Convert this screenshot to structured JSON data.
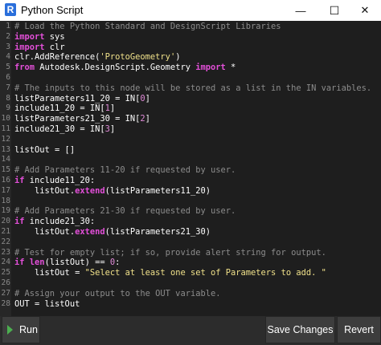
{
  "window": {
    "title": "Python Script",
    "app_icon_letter": "R",
    "minimize_glyph": "—",
    "maximize_glyph": "☐",
    "close_glyph": "✕",
    "icons": [
      "app-icon",
      "minimize-icon",
      "maximize-icon",
      "close-icon",
      "play-icon"
    ]
  },
  "colors": {
    "keyword": "#e34fd9",
    "comment": "#8c8c8c",
    "string": "#f0e18a",
    "number": "#e08ad8",
    "code_text": "#ffffff",
    "editor_bg": "#1e1e1e",
    "run_icon": "#4caf50"
  },
  "editor": {
    "lines": [
      {
        "n": "1",
        "tokens": [
          {
            "t": "# Load the Python Standard and DesignScript Libraries",
            "c": "cm"
          }
        ]
      },
      {
        "n": "2",
        "tokens": [
          {
            "t": "import",
            "c": "kw"
          },
          {
            "t": " sys",
            "c": ""
          }
        ]
      },
      {
        "n": "3",
        "tokens": [
          {
            "t": "import",
            "c": "kw"
          },
          {
            "t": " clr",
            "c": ""
          }
        ]
      },
      {
        "n": "4",
        "tokens": [
          {
            "t": "clr.AddReference(",
            "c": ""
          },
          {
            "t": "'ProtoGeometry'",
            "c": "st"
          },
          {
            "t": ")",
            "c": ""
          }
        ]
      },
      {
        "n": "5",
        "tokens": [
          {
            "t": "from",
            "c": "kw"
          },
          {
            "t": " Autodesk.DesignScript.Geometry ",
            "c": ""
          },
          {
            "t": "import",
            "c": "kw"
          },
          {
            "t": " *",
            "c": ""
          }
        ]
      },
      {
        "n": "6",
        "tokens": []
      },
      {
        "n": "7",
        "tokens": [
          {
            "t": "# The inputs to this node will be stored as a list in the IN variables.",
            "c": "cm"
          }
        ]
      },
      {
        "n": "8",
        "tokens": [
          {
            "t": "listParameters11_20 = IN[",
            "c": ""
          },
          {
            "t": "0",
            "c": "nm"
          },
          {
            "t": "]",
            "c": ""
          }
        ]
      },
      {
        "n": "9",
        "tokens": [
          {
            "t": "include11_20 = IN[",
            "c": ""
          },
          {
            "t": "1",
            "c": "nm"
          },
          {
            "t": "]",
            "c": ""
          }
        ]
      },
      {
        "n": "10",
        "tokens": [
          {
            "t": "listParameters21_30 = IN[",
            "c": ""
          },
          {
            "t": "2",
            "c": "nm"
          },
          {
            "t": "]",
            "c": ""
          }
        ]
      },
      {
        "n": "11",
        "tokens": [
          {
            "t": "include21_30 = IN[",
            "c": ""
          },
          {
            "t": "3",
            "c": "nm"
          },
          {
            "t": "]",
            "c": ""
          }
        ]
      },
      {
        "n": "12",
        "tokens": []
      },
      {
        "n": "13",
        "tokens": [
          {
            "t": "listOut = []",
            "c": ""
          }
        ]
      },
      {
        "n": "14",
        "tokens": []
      },
      {
        "n": "15",
        "tokens": [
          {
            "t": "# Add Parameters 11-20 if requested by user.",
            "c": "cm"
          }
        ]
      },
      {
        "n": "16",
        "tokens": [
          {
            "t": "if",
            "c": "kw"
          },
          {
            "t": " include11_20:",
            "c": ""
          }
        ]
      },
      {
        "n": "17",
        "tokens": [
          {
            "t": "    listOut.",
            "c": ""
          },
          {
            "t": "extend",
            "c": "kw"
          },
          {
            "t": "(listParameters11_20)",
            "c": ""
          }
        ]
      },
      {
        "n": "18",
        "tokens": []
      },
      {
        "n": "19",
        "tokens": [
          {
            "t": "# Add Parameters 21-30 if requested by user.",
            "c": "cm"
          }
        ]
      },
      {
        "n": "20",
        "tokens": [
          {
            "t": "if",
            "c": "kw"
          },
          {
            "t": " include21_30:",
            "c": ""
          }
        ]
      },
      {
        "n": "21",
        "tokens": [
          {
            "t": "    listOut.",
            "c": ""
          },
          {
            "t": "extend",
            "c": "kw"
          },
          {
            "t": "(listParameters21_30)",
            "c": ""
          }
        ]
      },
      {
        "n": "22",
        "tokens": []
      },
      {
        "n": "23",
        "tokens": [
          {
            "t": "# Test for empty list; if so, provide alert string for output.",
            "c": "cm"
          }
        ]
      },
      {
        "n": "24",
        "tokens": [
          {
            "t": "if",
            "c": "kw"
          },
          {
            "t": " ",
            "c": ""
          },
          {
            "t": "len",
            "c": "kw"
          },
          {
            "t": "(listOut) == ",
            "c": ""
          },
          {
            "t": "0",
            "c": "nm"
          },
          {
            "t": ":",
            "c": ""
          }
        ]
      },
      {
        "n": "25",
        "tokens": [
          {
            "t": "    listOut = ",
            "c": ""
          },
          {
            "t": "\"Select at least one set of Parameters to add. \"",
            "c": "st"
          }
        ]
      },
      {
        "n": "26",
        "tokens": []
      },
      {
        "n": "27",
        "tokens": [
          {
            "t": "# Assign your output to the OUT variable.",
            "c": "cm"
          }
        ]
      },
      {
        "n": "28",
        "tokens": [
          {
            "t": "OUT = listOut",
            "c": ""
          }
        ]
      }
    ]
  },
  "toolbar": {
    "run_label": "Run",
    "save_label": "Save Changes",
    "revert_label": "Revert"
  }
}
